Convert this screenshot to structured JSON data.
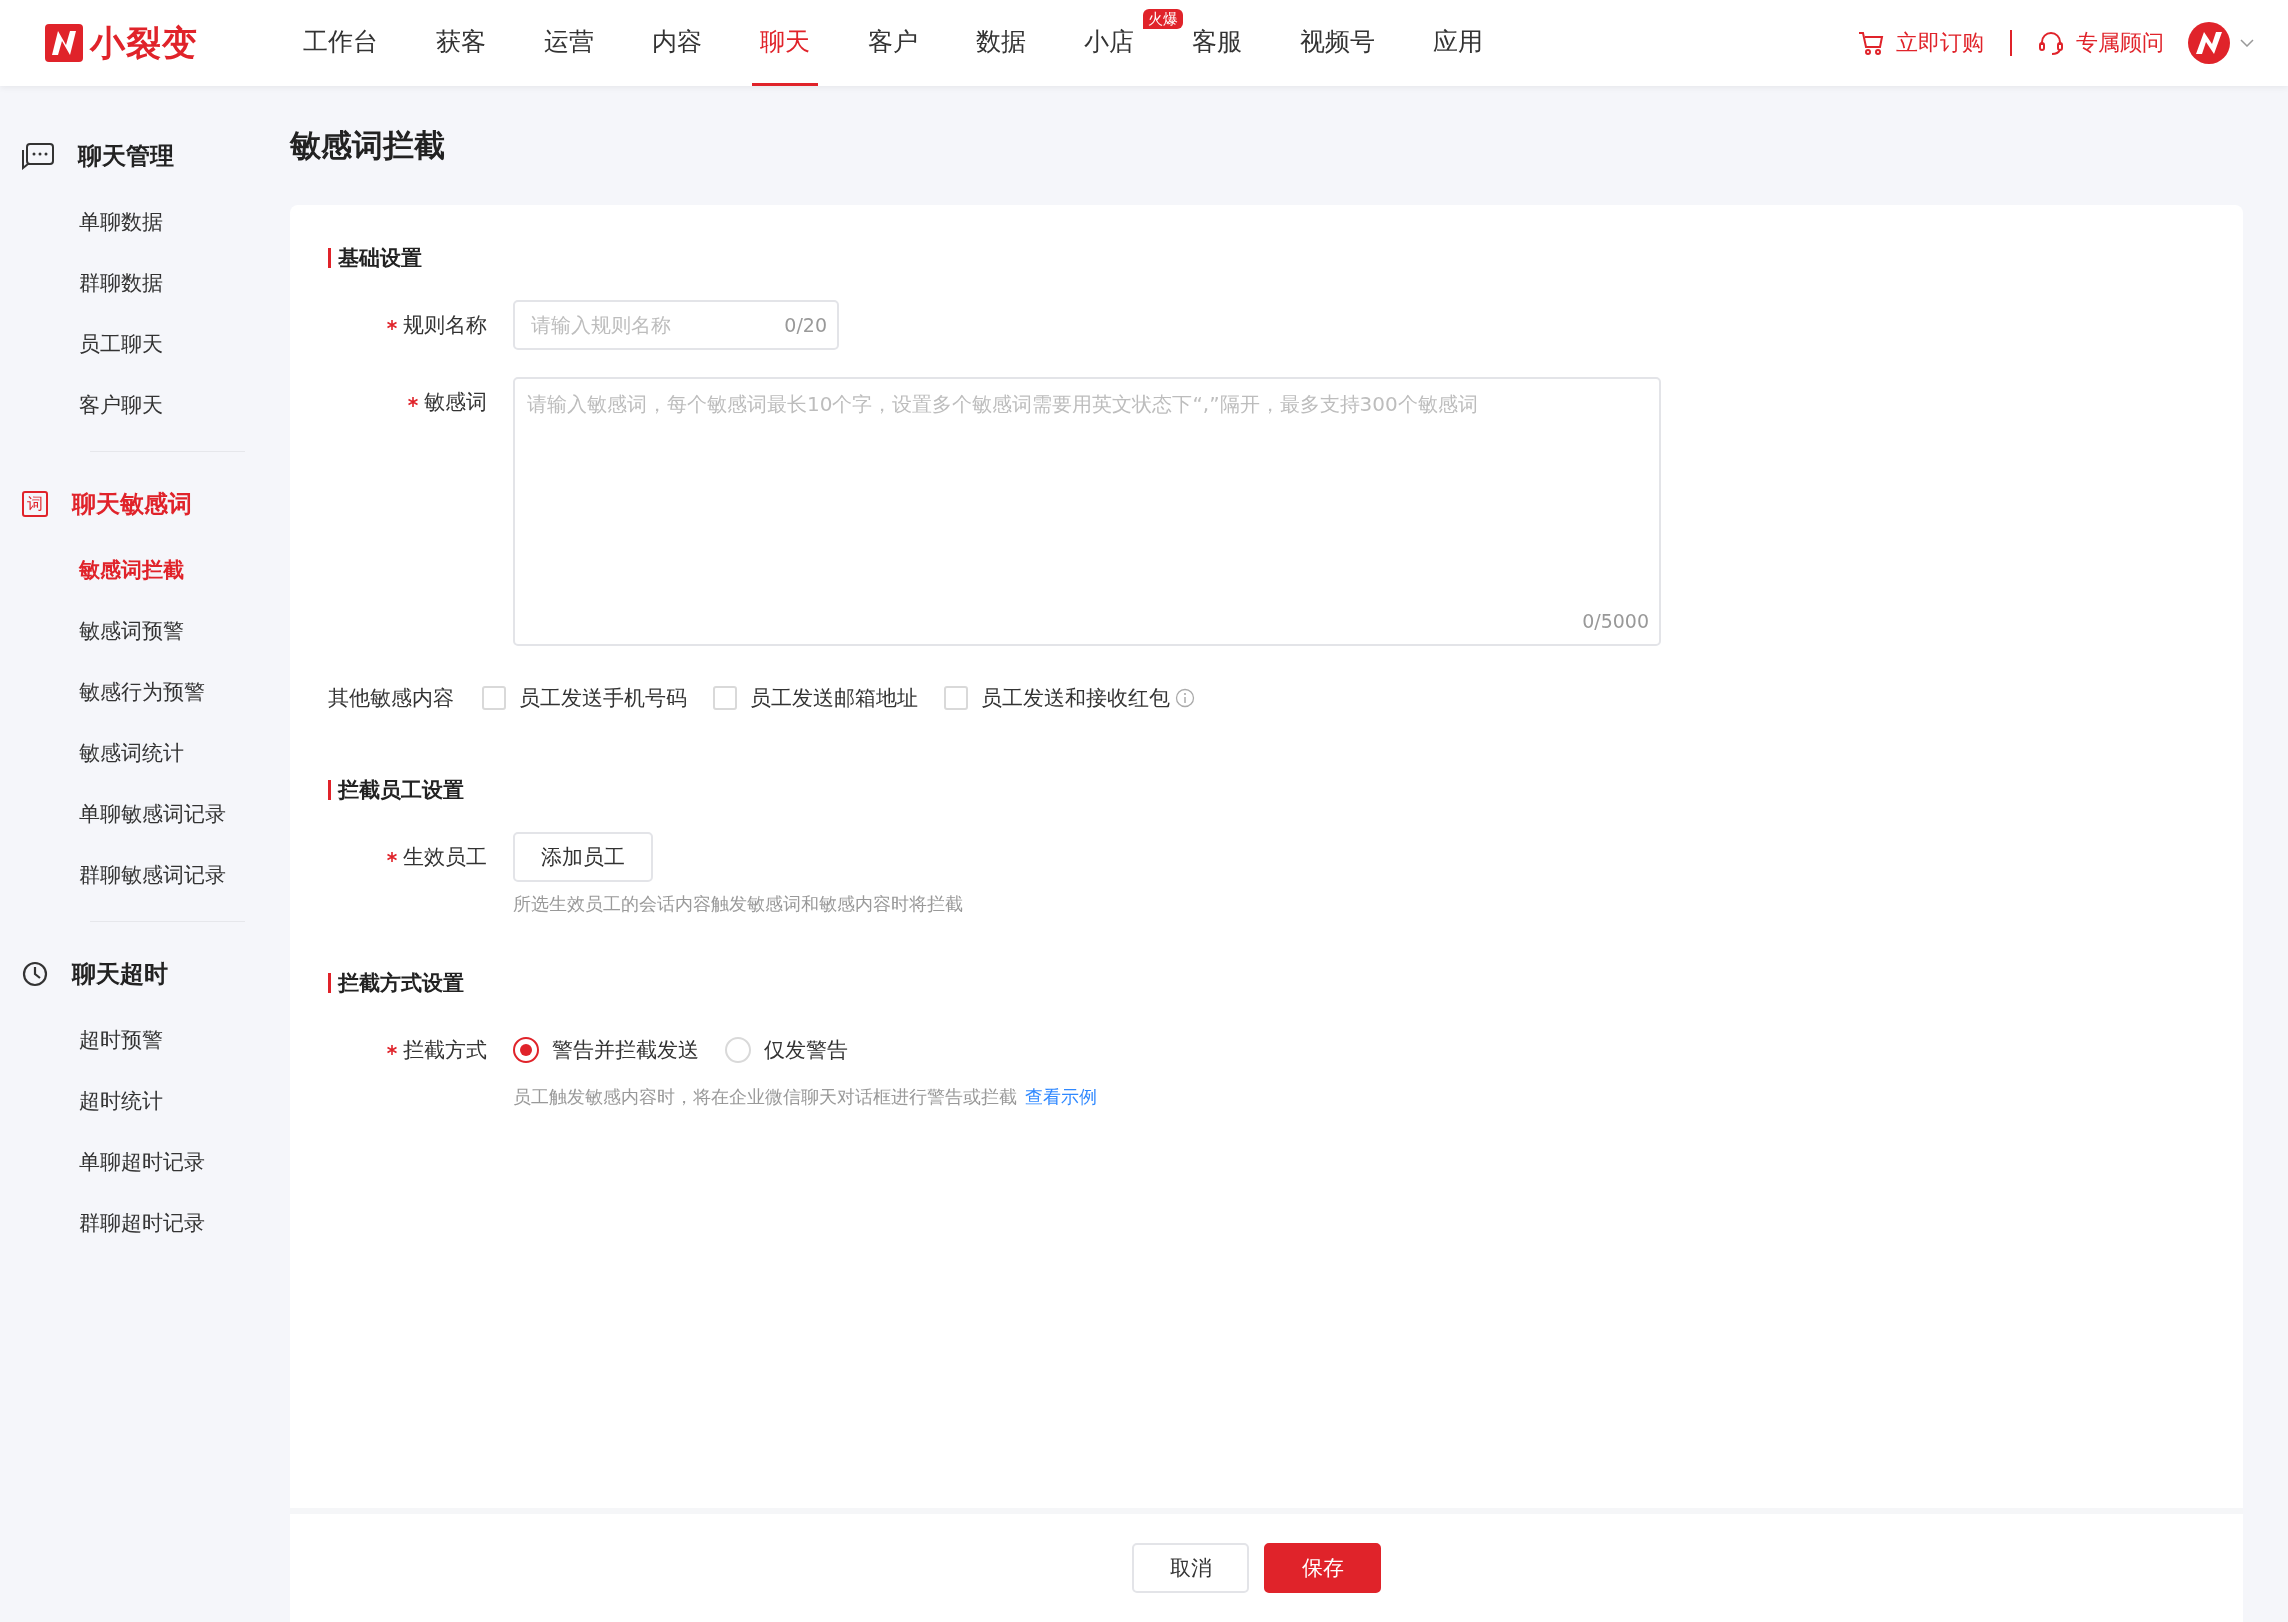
{
  "brand": {
    "name": "小裂变"
  },
  "nav": [
    {
      "label": "工作台",
      "selected": false
    },
    {
      "label": "获客",
      "selected": false
    },
    {
      "label": "运营",
      "selected": false
    },
    {
      "label": "内容",
      "selected": false
    },
    {
      "label": "聊天",
      "selected": true
    },
    {
      "label": "客户",
      "selected": false
    },
    {
      "label": "数据",
      "selected": false
    },
    {
      "label": "小店",
      "selected": false,
      "badge": "火爆"
    },
    {
      "label": "客服",
      "selected": false
    },
    {
      "label": "视频号",
      "selected": false
    },
    {
      "label": "应用",
      "selected": false
    }
  ],
  "header_actions": [
    {
      "label": "立即订购",
      "kind": "cart"
    },
    {
      "label": "专属顾问",
      "kind": "headset"
    }
  ],
  "sidebar": {
    "groups": [
      {
        "title": "聊天管理",
        "kind": "chat",
        "selected": false,
        "items": [
          {
            "label": "单聊数据",
            "selected": false
          },
          {
            "label": "群聊数据",
            "selected": false
          },
          {
            "label": "员工聊天",
            "selected": false
          },
          {
            "label": "客户聊天",
            "selected": false
          }
        ]
      },
      {
        "title": "聊天敏感词",
        "kind": "glyph",
        "icon_glyph": "词",
        "selected": true,
        "items": [
          {
            "label": "敏感词拦截",
            "selected": true
          },
          {
            "label": "敏感词预警",
            "selected": false
          },
          {
            "label": "敏感行为预警",
            "selected": false
          },
          {
            "label": "敏感词统计",
            "selected": false
          },
          {
            "label": "单聊敏感词记录",
            "selected": false
          },
          {
            "label": "群聊敏感词记录",
            "selected": false
          }
        ]
      },
      {
        "title": "聊天超时",
        "kind": "clock",
        "selected": false,
        "items": [
          {
            "label": "超时预警",
            "selected": false
          },
          {
            "label": "超时统计",
            "selected": false
          },
          {
            "label": "单聊超时记录",
            "selected": false
          },
          {
            "label": "群聊超时记录",
            "selected": false
          }
        ]
      }
    ]
  },
  "page_title": "敏感词拦截",
  "sections": [
    {
      "title": "基础设置",
      "fields": [
        {
          "kind": "input",
          "label": "规则名称",
          "required": true,
          "placeholder": "请输入规则名称",
          "counter": "0/20"
        },
        {
          "kind": "textarea",
          "label": "敏感词",
          "required": true,
          "placeholder": "请输入敏感词，每个敏感词最长10个字，设置多个敏感词需要用英文状态下“,”隔开，最多支持300个敏感词",
          "counter": "0/5000"
        },
        {
          "kind": "checkboxes",
          "label": "其他敏感内容",
          "required": false,
          "options": [
            {
              "label": "员工发送手机号码",
              "checked": false,
              "info": false
            },
            {
              "label": "员工发送邮箱地址",
              "checked": false,
              "info": false
            },
            {
              "label": "员工发送和接收红包",
              "checked": false,
              "info": true
            }
          ]
        }
      ]
    },
    {
      "title": "拦截员工设置",
      "fields": [
        {
          "kind": "button",
          "label": "生效员工",
          "required": true,
          "button": "添加员工",
          "hint": "所选生效员工的会话内容触发敏感词和敏感内容时将拦截"
        }
      ]
    },
    {
      "title": "拦截方式设置",
      "fields": [
        {
          "kind": "radios",
          "label": "拦截方式",
          "required": true,
          "options": [
            {
              "label": "警告并拦截发送",
              "selected": true
            },
            {
              "label": "仅发警告",
              "selected": false
            }
          ],
          "hint": "员工触发敏感内容时，将在企业微信聊天对话框进行警告或拦截",
          "link": "查看示例"
        }
      ]
    }
  ],
  "footer": {
    "buttons": [
      {
        "label": "取消",
        "kind": "default"
      },
      {
        "label": "保存",
        "kind": "primary"
      }
    ]
  }
}
